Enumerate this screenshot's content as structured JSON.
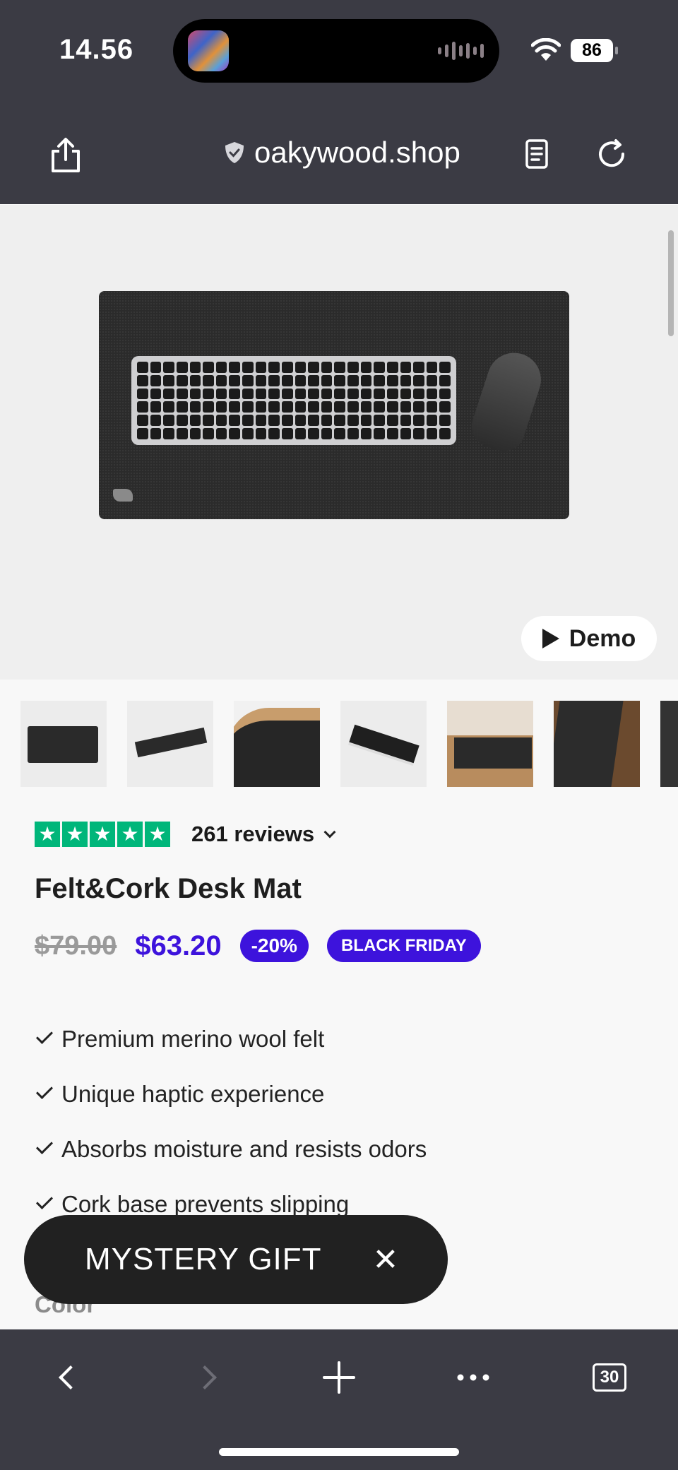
{
  "status_bar": {
    "time": "14.56",
    "battery": "86"
  },
  "browser": {
    "url": "oakywood.shop",
    "tab_count": "30"
  },
  "hero": {
    "demo_label": "Demo"
  },
  "thumbnails": [
    "thumb-1",
    "thumb-2",
    "thumb-3",
    "thumb-4",
    "thumb-5",
    "thumb-6",
    "thumb-7"
  ],
  "product": {
    "rating_stars": 5,
    "reviews_label": "261 reviews",
    "title": "Felt&Cork Desk Mat",
    "old_price": "$79.00",
    "new_price": "$63.20",
    "discount_badge": "-20%",
    "promo_badge": "BLACK FRIDAY",
    "features": [
      "Premium merino wool felt",
      "Unique haptic experience",
      "Absorbs moisture and resists odors",
      "Cork base prevents slipping"
    ],
    "color_label": "Color"
  },
  "popup": {
    "label": "MYSTERY GIFT",
    "close": "✕"
  },
  "colors": {
    "accent": "#3d13dc",
    "trustpilot": "#00b67a",
    "chrome": "#3b3b44"
  }
}
